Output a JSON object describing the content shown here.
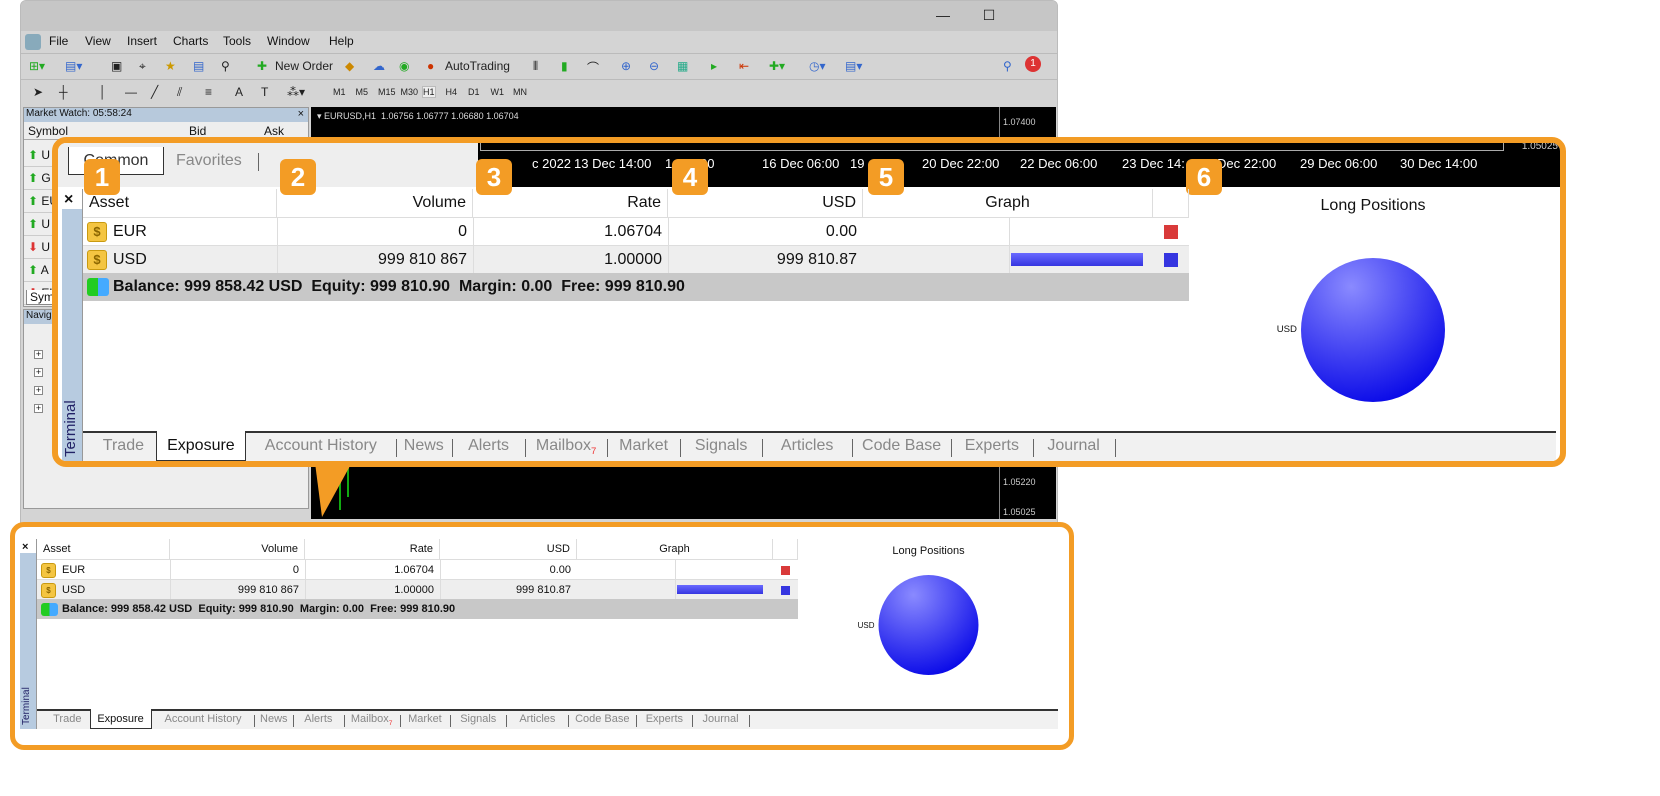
{
  "window": {
    "menu": [
      "File",
      "View",
      "Insert",
      "Charts",
      "Tools",
      "Window",
      "Help"
    ],
    "toolbar": {
      "new_order": "New Order",
      "autotrading": "AutoTrading",
      "notification_count": "1"
    },
    "timeframes": [
      "M1",
      "M5",
      "M15",
      "M30",
      "H1",
      "H4",
      "D1",
      "W1",
      "MN"
    ],
    "market_watch": {
      "title": "Market Watch: 05:58:24",
      "columns": [
        "Symbol",
        "Bid",
        "Ask"
      ],
      "rows": [
        {
          "s": "U",
          "dir": "up"
        },
        {
          "s": "G",
          "dir": "up"
        },
        {
          "s": "EU",
          "dir": "up"
        },
        {
          "s": "U",
          "dir": "up"
        },
        {
          "s": "U",
          "dir": "down"
        },
        {
          "s": "A",
          "dir": "up"
        },
        {
          "s": "EU",
          "dir": "down"
        }
      ],
      "tab": "Sym"
    },
    "navigator": {
      "title": "Navig"
    },
    "chart": {
      "header": "EURUSD,H1  1.06756 1.06777 1.06680 1.06704",
      "prices": [
        "1.07400",
        "1.05220",
        "1.05025"
      ],
      "time_labels": [
        "c 2022",
        "13 Dec 14:00",
        "1",
        "22:00",
        "16 Dec 06:00",
        "19",
        ":00",
        "20 Dec 22:00",
        "22 Dec 06:00",
        "23 Dec 14:",
        "Dec 22:00",
        "29 Dec 06:00",
        "30 Dec 14:00"
      ],
      "price_top_right": "1.05025"
    }
  },
  "callout": {
    "badges": [
      "1",
      "2",
      "3",
      "4",
      "5",
      "6"
    ],
    "tabs_top": [
      "Common",
      "Favorites"
    ]
  },
  "terminal": {
    "label": "Terminal",
    "close": "×",
    "columns": [
      "Asset",
      "Volume",
      "Rate",
      "USD",
      "Graph"
    ],
    "rows": [
      {
        "asset": "EUR",
        "volume": "0",
        "rate": "1.06704",
        "usd": "0.00",
        "bar": 0,
        "color": "#d93a3a"
      },
      {
        "asset": "USD",
        "volume": "999 810 867",
        "rate": "1.00000",
        "usd": "999 810.87",
        "bar": 1,
        "color": "#3535e0"
      }
    ],
    "summary": "Balance: 999 858.42 USD  Equity: 999 810.90  Margin: 0.00  Free: 999 810.90",
    "pie": {
      "title": "Long Positions",
      "slices": [
        {
          "label": "USD",
          "value": 100
        }
      ]
    },
    "tabs": [
      "Trade",
      "Exposure",
      "Account History",
      "News",
      "Alerts",
      "Mailbox",
      "Market",
      "Signals",
      "Articles",
      "Code Base",
      "Experts",
      "Journal"
    ],
    "active_tab": "Exposure",
    "mailbox_badge": "7"
  },
  "colors": {
    "accent": "#f39c25",
    "bar": "#3535e0"
  }
}
